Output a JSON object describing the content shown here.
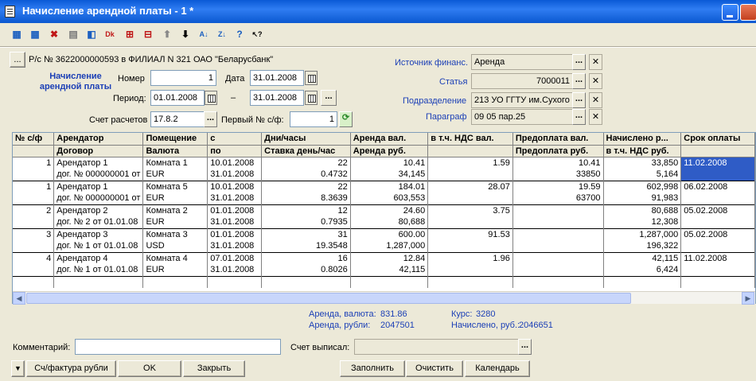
{
  "window": {
    "title": "Начисление арендной платы - 1 *"
  },
  "toolbar": {
    "icons": [
      "new-row-icon",
      "copy-row-icon",
      "delete-row-icon",
      "edit-row-icon",
      "mark-delete-icon",
      "dk-icon",
      "fill-icon",
      "calc-icon",
      "move-up-icon",
      "move-down-icon",
      "sort-asc-icon",
      "sort-desc-icon",
      "help-icon",
      "what-is-icon"
    ],
    "glyphs": [
      "▦",
      "▦",
      "✖",
      "▤",
      "◧",
      "Dk",
      "⊞",
      "⊟",
      "⬆",
      "⬇",
      "A↓",
      "Z↓",
      "?",
      "↖?"
    ]
  },
  "account": {
    "btn": "...",
    "text": "Р/с № 3622000000593 в ФИЛИАЛ N 321 ОАО \"Беларусбанк\""
  },
  "doc": {
    "heading1": "Начисление",
    "heading2": "арендной платы",
    "number_label": "Номер",
    "number": "1",
    "date_label": "Дата",
    "date": "31.01.2008",
    "period_label": "Период:",
    "period_from": "01.01.2008",
    "dash": "–",
    "period_to": "31.01.2008",
    "account_label": "Счет расчетов",
    "account_value": "17.8.2",
    "first_sf_label": "Первый № с/ф:",
    "first_sf": "1"
  },
  "right": {
    "source_label": "Источник финанс.",
    "source": "Аренда",
    "article_label": "Статья",
    "article": "7000011",
    "division_label": "Подразделение",
    "division": "213 УО ГГТУ им.Сухого",
    "paragraph_label": "Параграф",
    "paragraph": "09 05 пар.25"
  },
  "grid": {
    "headers1": [
      "№ с/ф",
      "Арендатор",
      "Помещение",
      "с",
      "Дни/часы",
      "Аренда вал.",
      "в т.ч. НДС вал.",
      "Предоплата вал.",
      "Начислено р...",
      "Срок оплаты"
    ],
    "headers2": [
      "",
      "Договор",
      "Валюта",
      "по",
      "Ставка день/час",
      "Аренда руб.",
      "",
      "Предоплата руб.",
      "в т.ч. НДС руб.",
      ""
    ],
    "rows": [
      {
        "a": [
          "1",
          "Арендатор 1",
          "Комната 1",
          "10.01.2008",
          "22",
          "10.41",
          "1.59",
          "10.41",
          "33,850",
          "11.02.2008"
        ],
        "b": [
          "",
          "дог. № 000000001 от",
          "EUR",
          "31.01.2008",
          "0.4732",
          "34,145",
          "",
          "33850",
          "5,164",
          ""
        ],
        "sel": true
      },
      {
        "a": [
          "1",
          "Арендатор 1",
          "Комната 5",
          "10.01.2008",
          "22",
          "184.01",
          "28.07",
          "19.59",
          "602,998",
          "06.02.2008"
        ],
        "b": [
          "",
          "дог. № 000000001 от",
          "EUR",
          "31.01.2008",
          "8.3639",
          "603,553",
          "",
          "63700",
          "91,983",
          ""
        ]
      },
      {
        "a": [
          "2",
          "Арендатор 2",
          "Комната 2",
          "01.01.2008",
          "12",
          "24.60",
          "3.75",
          "",
          "80,688",
          "05.02.2008"
        ],
        "b": [
          "",
          "дог. № 2 от 01.01.08",
          "EUR",
          "31.01.2008",
          "0.7935",
          "80,688",
          "",
          "",
          "12,308",
          ""
        ]
      },
      {
        "a": [
          "3",
          "Арендатор 3",
          "Комната 3",
          "01.01.2008",
          "31",
          "600.00",
          "91.53",
          "",
          "1,287,000",
          "05.02.2008"
        ],
        "b": [
          "",
          "дог. № 1 от 01.01.08",
          "USD",
          "31.01.2008",
          "19.3548",
          "1,287,000",
          "",
          "",
          "196,322",
          ""
        ]
      },
      {
        "a": [
          "4",
          "Арендатор 4",
          "Комната 4",
          "07.01.2008",
          "16",
          "12.84",
          "1.96",
          "",
          "42,115",
          "11.02.2008"
        ],
        "b": [
          "",
          "дог. № 1 от 01.01.08",
          "EUR",
          "31.01.2008",
          "0.8026",
          "42,115",
          "",
          "",
          "6,424",
          ""
        ]
      }
    ]
  },
  "totals": {
    "rent_cur_label": "Аренда, валюта:",
    "rent_cur": "831.86",
    "rent_rub_label": "Аренда, рубли:",
    "rent_rub": "2047501",
    "rate_label": "Курс:",
    "rate": "3280",
    "accrued_label": "Начислено, руб.:",
    "accrued": "2046651"
  },
  "bottom": {
    "comment_label": "Комментарий:",
    "comment": "",
    "issued_label": "Счет выписал:",
    "issued": "",
    "menu_arrow": "▼",
    "sf_rub": "Сч/фактура рубли",
    "ok": "OK",
    "close": "Закрыть",
    "fill": "Заполнить",
    "clear": "Очистить",
    "calendar": "Календарь"
  }
}
